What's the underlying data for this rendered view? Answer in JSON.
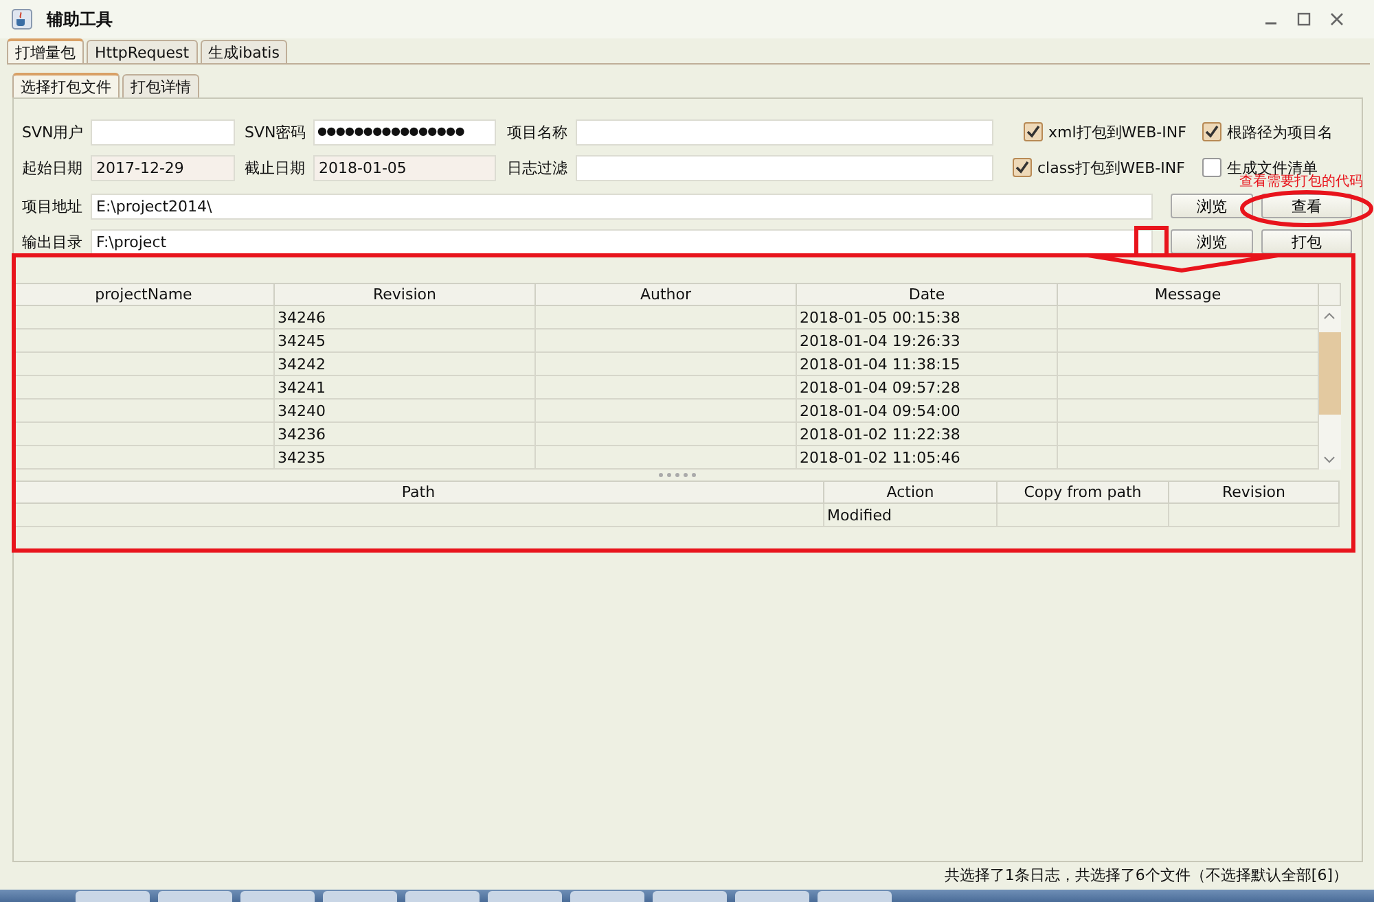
{
  "window": {
    "title": "辅助工具"
  },
  "tabs": [
    {
      "label": "打增量包",
      "selected": true
    },
    {
      "label": "HttpRequest",
      "selected": false
    },
    {
      "label": "生成ibatis",
      "selected": false
    }
  ],
  "subtabs": [
    {
      "label": "选择打包文件",
      "selected": true
    },
    {
      "label": "打包详情",
      "selected": false
    }
  ],
  "fields": [
    {
      "label": "SVN用户",
      "editable": true
    },
    {
      "label": "SVN密码",
      "value": "●●●●●●●●●●●●●●●●",
      "editable": true
    },
    {
      "label": "项目名称",
      "editable": true
    },
    {
      "label": "起始日期",
      "value": "2017-12-29",
      "editable": false
    },
    {
      "label": "截止日期",
      "value": "2018-01-05",
      "editable": false
    },
    {
      "label": "日志过滤",
      "editable": true
    },
    {
      "label": "项目地址",
      "value": "E:\\project2014\\",
      "editable": true
    },
    {
      "label": "输出目录",
      "value": "F:\\project",
      "editable": true
    }
  ],
  "checkboxes": [
    {
      "label": "xml打包到WEB-INF",
      "checked": true
    },
    {
      "label": "根路径为项目名",
      "checked": true
    },
    {
      "label": "class打包到WEB-INF",
      "checked": true
    },
    {
      "label": "生成文件清单",
      "checked": false
    }
  ],
  "buttons": [
    "浏览",
    "查看",
    "浏览",
    "打包"
  ],
  "log_table": {
    "columns": [
      "projectName",
      "Revision",
      "Author",
      "Date",
      "Message"
    ],
    "rows": [
      {
        "revision": "34246",
        "date": "2018-01-05 00:15:38"
      },
      {
        "revision": "34245",
        "date": "2018-01-04 19:26:33"
      },
      {
        "revision": "34242",
        "date": "2018-01-04 11:38:15"
      },
      {
        "revision": "34241",
        "date": "2018-01-04 09:57:28"
      },
      {
        "revision": "34240",
        "date": "2018-01-04 09:54:00"
      },
      {
        "revision": "34236",
        "date": "2018-01-02 11:22:38"
      },
      {
        "revision": "34235",
        "date": "2018-01-02 11:05:46"
      }
    ]
  },
  "files_table": {
    "columns": [
      "Path",
      "Action",
      "Copy from path",
      "Revision"
    ],
    "rows": [
      {
        "action": "Modified"
      }
    ]
  },
  "status_text": "共选择了1条日志，共选择了6个文件（不选择默认全部[6]）",
  "annotation": "查看需要打包的代码"
}
